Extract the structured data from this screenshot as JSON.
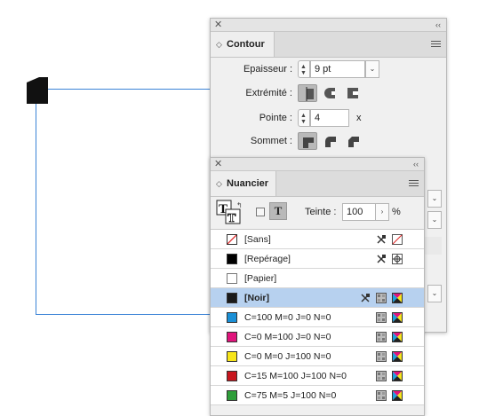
{
  "contour": {
    "tab_label": "Contour",
    "epaisseur_label": "Epaisseur :",
    "epaisseur_value": "9 pt",
    "extremite_label": "Extrémité :",
    "pointe_label": "Pointe :",
    "pointe_value": "4",
    "pointe_unit": "x",
    "sommet_label": "Sommet :"
  },
  "nuancier": {
    "tab_label": "Nuancier",
    "teinte_label": "Teinte :",
    "teinte_value": "100",
    "teinte_unit": "%",
    "swatches": [
      {
        "name": "[Sans]",
        "color": "none",
        "icons": [
          "no-edit-icon",
          "none-swatch-icon"
        ]
      },
      {
        "name": "[Repérage]",
        "color": "#000000",
        "icons": [
          "no-edit-icon",
          "registration-icon"
        ]
      },
      {
        "name": "[Papier]",
        "color": "#ffffff",
        "icons": []
      },
      {
        "name": "[Noir]",
        "color": "#1a1a1a",
        "icons": [
          "no-edit-icon",
          "process-icon",
          "cmyk-icon"
        ],
        "selected": true
      },
      {
        "name": "C=100 M=0 J=0 N=0",
        "color": "#1a8fd6",
        "icons": [
          "process-icon",
          "cmyk-icon"
        ]
      },
      {
        "name": "C=0 M=100 J=0 N=0",
        "color": "#e0147c",
        "icons": [
          "process-icon",
          "cmyk-icon"
        ]
      },
      {
        "name": "C=0 M=0 J=100 N=0",
        "color": "#f7e51a",
        "icons": [
          "process-icon",
          "cmyk-icon"
        ]
      },
      {
        "name": "C=15 M=100 J=100 N=0",
        "color": "#c8161e",
        "icons": [
          "process-icon",
          "cmyk-icon"
        ]
      },
      {
        "name": "C=75 M=5 J=100 N=0",
        "color": "#2e9e3a",
        "icons": [
          "process-icon",
          "cmyk-icon"
        ]
      }
    ]
  },
  "colors": {
    "selection": "#b7d1ef",
    "frame": "#3b83d6"
  }
}
